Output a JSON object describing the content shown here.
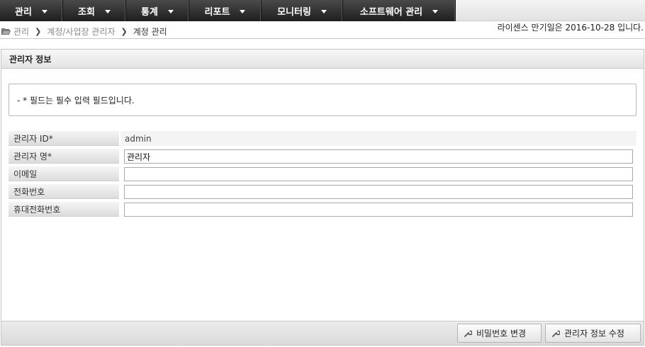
{
  "nav": {
    "items": [
      {
        "label": "관리"
      },
      {
        "label": "조회"
      },
      {
        "label": "통계"
      },
      {
        "label": "리포트"
      },
      {
        "label": "모니터링"
      },
      {
        "label": "소프트웨어 관리"
      }
    ]
  },
  "breadcrumb": {
    "items": [
      "관리",
      "계정/사업장 관리자",
      "계정 관리"
    ],
    "icon": "folder-open-icon"
  },
  "license_text": "라이센스 만기일은 2016-10-28 입니다.",
  "panel": {
    "title": "관리자 정보",
    "notice": "- * 필드는 필수 입력 필드입니다.",
    "fields": [
      {
        "label": "관리자 ID*",
        "value": "admin"
      },
      {
        "label": "관리자 명*",
        "value": "관리자"
      },
      {
        "label": "이메일",
        "value": ""
      },
      {
        "label": "전화번호",
        "value": ""
      },
      {
        "label": "휴대전화번호",
        "value": ""
      }
    ]
  },
  "buttons": {
    "change_password": "비밀번호 변경",
    "edit_admin": "관리자 정보 수정",
    "icon": "wrench-icon"
  },
  "colors": {
    "nav_bg": "#2d2d2d",
    "panel_header": "#e9e9e9"
  }
}
